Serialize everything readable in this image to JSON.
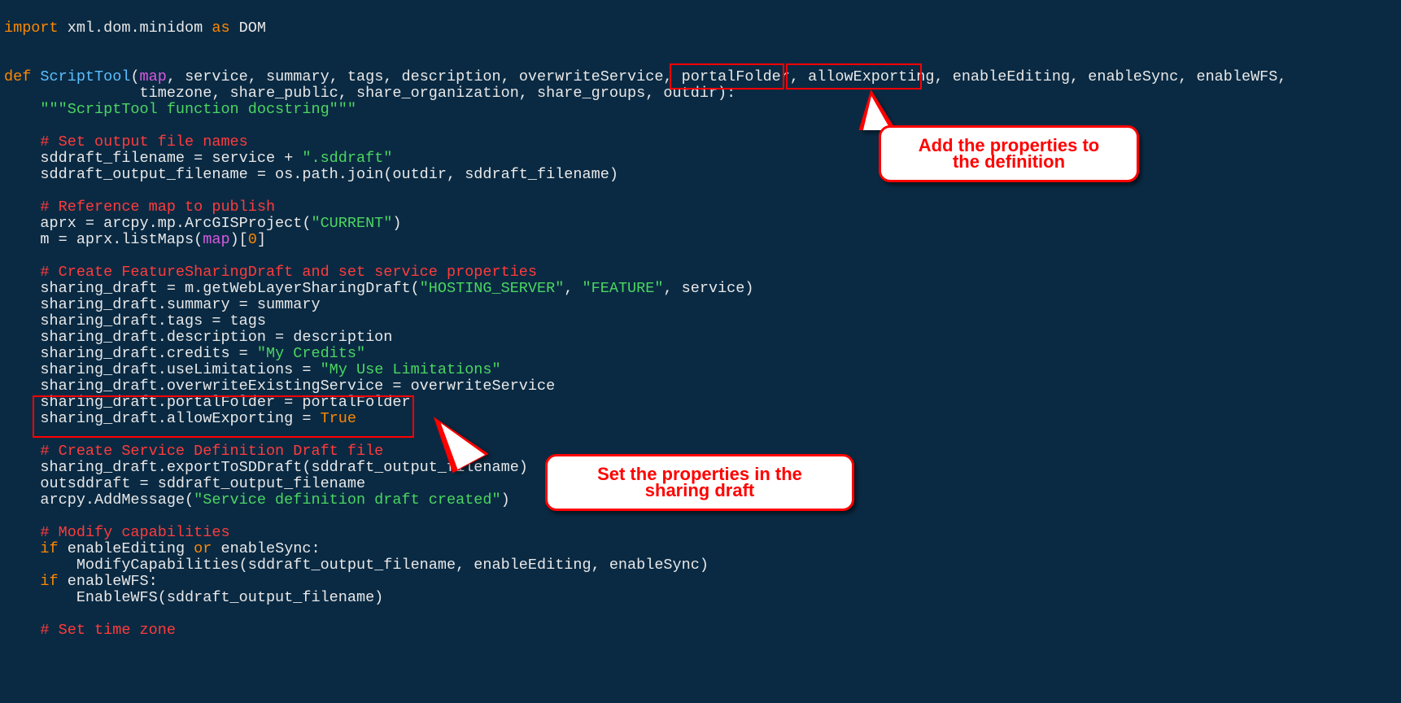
{
  "annotations": {
    "callout_top_line1": "Add the properties to",
    "callout_top_line2": "the definition",
    "callout_bottom_line1": "Set the properties in the",
    "callout_bottom_line2": "sharing draft"
  },
  "code": {
    "t01_import": "import",
    "t01_mod": " xml.dom.minidom ",
    "t01_as": "as",
    "t01_alias": " DOM",
    "t03_def": "def",
    "t03_fnname": " ScriptTool",
    "t03_open": "(",
    "t03_map": "map",
    "t03_params1": ", service, summary, tags, description, overwriteService, portalFolder, allowExporting, enableEditing, enableSync, enableWFS,",
    "t04_params2": "               timezone, share_public, share_organization, share_groups, outdir):",
    "t05_docstring": "    \"\"\"ScriptTool function docstring\"\"\"",
    "c07": "    # Set output file names",
    "t08a": "    sddraft_filename = service + ",
    "t08b": "\".sddraft\"",
    "t09a": "    sddraft_output_filename = os.path.join(outdir, sddraft_filename)",
    "c11": "    # Reference map to publish",
    "t12a": "    aprx = arcpy.mp.ArcGISProject(",
    "t12b": "\"CURRENT\"",
    "t12c": ")",
    "t13a": "    m = aprx.listMaps(",
    "t13b": "map",
    "t13c": ")[",
    "t13d": "0",
    "t13e": "]",
    "c15": "    # Create FeatureSharingDraft and set service properties",
    "t16a": "    sharing_draft = m.getWebLayerSharingDraft(",
    "t16b": "\"HOSTING_SERVER\"",
    "t16c": ", ",
    "t16d": "\"FEATURE\"",
    "t16e": ", service)",
    "t17": "    sharing_draft.summary = summary",
    "t18": "    sharing_draft.tags = tags",
    "t19": "    sharing_draft.description = description",
    "t20a": "    sharing_draft.credits = ",
    "t20b": "\"My Credits\"",
    "t21a": "    sharing_draft.useLimitations = ",
    "t21b": "\"My Use Limitations\"",
    "t22": "    sharing_draft.overwriteExistingService = overwriteService",
    "t23": "    sharing_draft.portalFolder = portalFolder",
    "t24a": "    sharing_draft.allowExporting = ",
    "t24b": "True",
    "c26": "    # Create Service Definition Draft file",
    "t27": "    sharing_draft.exportToSDDraft(sddraft_output_filename)",
    "t28": "    outsddraft = sddraft_output_filename",
    "t29a": "    arcpy.AddMessage(",
    "t29b": "\"Service definition draft created\"",
    "t29c": ")",
    "c31": "    # Modify capabilities",
    "t32a": "    ",
    "t32if": "if",
    "t32b": " enableEditing ",
    "t32or": "or",
    "t32c": " enableSync:",
    "t33": "        ModifyCapabilities(sddraft_output_filename, enableEditing, enableSync)",
    "t34a": "    ",
    "t34if": "if",
    "t34b": " enableWFS:",
    "t35": "        EnableWFS(sddraft_output_filename)",
    "c37": "    # Set time zone"
  }
}
